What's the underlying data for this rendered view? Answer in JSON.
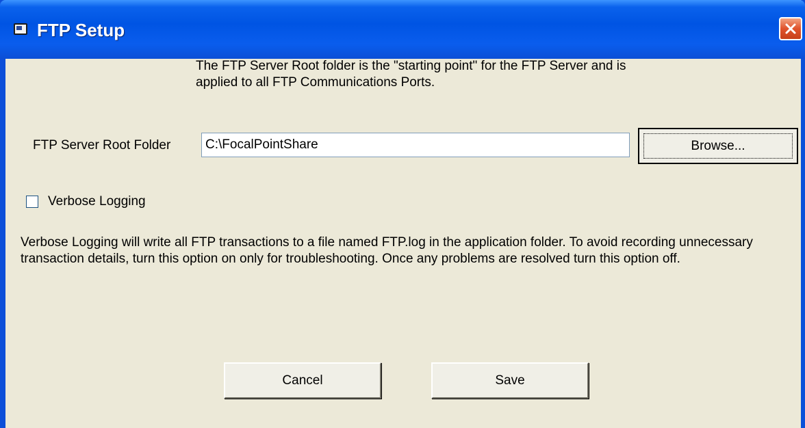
{
  "window": {
    "title": "FTP Setup",
    "icon": "window-app-icon",
    "close_icon": "close-icon"
  },
  "intro_text": "The FTP Server Root folder is the \"starting point\" for the FTP Server and is applied to all FTP Communications Ports.",
  "root_folder": {
    "label": "FTP Server Root Folder",
    "value": "C:\\FocalPointShare",
    "browse_label": "Browse..."
  },
  "verbose": {
    "label": "Verbose Logging",
    "checked": false,
    "description": "Verbose Logging will write all FTP transactions to a file named FTP.log in the application folder.  To avoid recording unnecessary transaction details, turn this option on only for troubleshooting.  Once any problems are resolved turn this option off."
  },
  "buttons": {
    "cancel_label": "Cancel",
    "save_label": "Save"
  },
  "colors": {
    "titlebar": "#0054e3",
    "dialog_bg": "#ece9d8",
    "close_button": "#e0532c"
  }
}
